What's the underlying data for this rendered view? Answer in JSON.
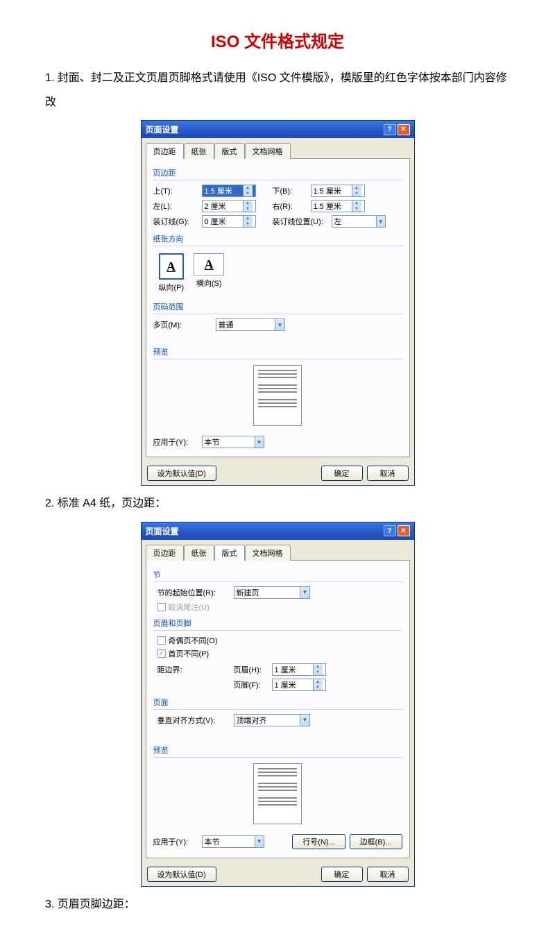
{
  "title": "ISO 文件格式规定",
  "para1": "1. 封面、封二及正文页眉页脚格式请使用《ISO 文件模版》，模版里的红色字体按本部门内容修改",
  "para2": "2. 标准 A4 纸，页边距：",
  "para3": "3. 页眉页脚边距：",
  "dialog1": {
    "title": "页面设置",
    "tabs": {
      "t1": "页边距",
      "t2": "纸张",
      "t3": "版式",
      "t4": "文档网格"
    },
    "margins_label": "页边距",
    "top_label": "上(T):",
    "top_val": "1.5 厘米",
    "bottom_label": "下(B):",
    "bottom_val": "1.5 厘米",
    "left_label": "左(L):",
    "left_val": "2 厘米",
    "right_label": "右(R):",
    "right_val": "1.5 厘米",
    "gutter_label": "装订线(G):",
    "gutter_val": "0 厘米",
    "gutter_pos_label": "装订线位置(U):",
    "gutter_pos_val": "左",
    "orient_label": "纸张方向",
    "portrait": "纵向(P)",
    "landscape": "横向(S)",
    "pages_label": "页码范围",
    "multi_label": "多页(M):",
    "multi_val": "普通",
    "preview_label": "预览",
    "apply_label": "应用于(Y):",
    "apply_val": "本节",
    "default_btn": "设为默认值(D)",
    "ok_btn": "确定",
    "cancel_btn": "取消"
  },
  "dialog2": {
    "title": "页面设置",
    "tabs": {
      "t1": "页边距",
      "t2": "纸张",
      "t3": "版式",
      "t4": "文档网格"
    },
    "section_label": "节",
    "section_start_label": "节的起始位置(R):",
    "section_start_val": "新建页",
    "suppress_endnotes": "取消尾注(U)",
    "headerfooter_label": "页眉和页脚",
    "odd_even": "奇偶页不同(O)",
    "first_page": "首页不同(P)",
    "from_edge": "距边界:",
    "header_label": "页眉(H):",
    "header_val": "1 厘米",
    "footer_label": "页脚(F):",
    "footer_val": "1 厘米",
    "page_label": "页面",
    "valign_label": "垂直对齐方式(V):",
    "valign_val": "顶端对齐",
    "preview_label": "预览",
    "apply_label": "应用于(Y):",
    "apply_val": "本节",
    "line_numbers_btn": "行号(N)...",
    "borders_btn": "边框(B)...",
    "default_btn": "设为默认值(D)",
    "ok_btn": "确定",
    "cancel_btn": "取消"
  }
}
